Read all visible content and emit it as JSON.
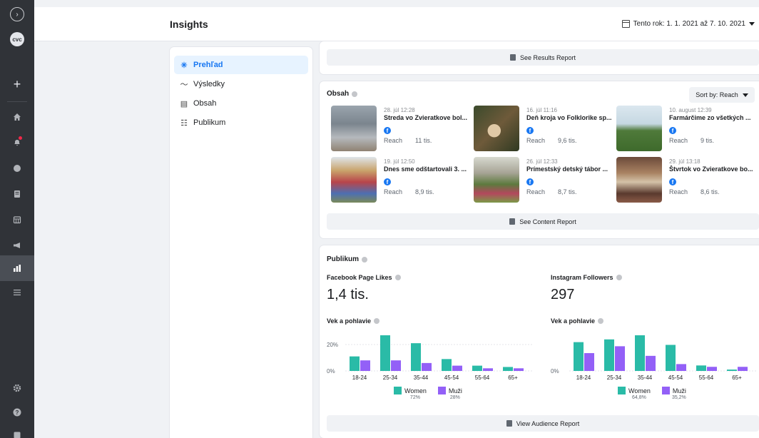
{
  "app": {
    "title": "Insights",
    "date_range": "Tento rok: 1. 1. 2021 až 7. 10. 2021"
  },
  "rail": {
    "logo_text": "cvc",
    "items": [
      "meta-icon",
      "logo",
      "plus-icon",
      "home-icon",
      "notifications-icon",
      "chat-icon",
      "pages-icon",
      "calendar-icon",
      "ads-icon",
      "insights-icon",
      "menu-icon",
      "settings-icon",
      "help-icon",
      "profile-icon"
    ]
  },
  "nav": {
    "items": [
      {
        "label": "Prehľad",
        "icon": "overview-icon",
        "active": true
      },
      {
        "label": "Výsledky",
        "icon": "results-icon",
        "active": false
      },
      {
        "label": "Obsah",
        "icon": "content-icon",
        "active": false
      },
      {
        "label": "Publikum",
        "icon": "audience-icon",
        "active": false
      }
    ]
  },
  "results_card": {
    "button_label": "See Results Report"
  },
  "content_card": {
    "title": "Obsah",
    "sort_label": "Sort by: Reach",
    "reach_label": "Reach",
    "button_label": "See Content Report",
    "posts": [
      {
        "date": "28. júl 12:28",
        "title": "Streda vo Zvieratkove bol...",
        "reach": "11 tis."
      },
      {
        "date": "16. júl 11:16",
        "title": "Deň kroja vo Folklorike sp...",
        "reach": "9,6 tis."
      },
      {
        "date": "10. august 12:39",
        "title": "Farmárčime zo všetkých ...",
        "reach": "9 tis."
      },
      {
        "date": "19. júl 12:50",
        "title": "Dnes sme odštartovali 3. ...",
        "reach": "8,9 tis."
      },
      {
        "date": "26. júl 12:33",
        "title": "Prímestský detský tábor ...",
        "reach": "8,7 tis."
      },
      {
        "date": "29. júl 13:18",
        "title": "Štvrtok vo Zvieratkove bo...",
        "reach": "8,6 tis."
      }
    ]
  },
  "audience_card": {
    "title": "Publikum",
    "button_label": "View Audience Report",
    "facebook": {
      "label": "Facebook Page Likes",
      "value": "1,4 tis.",
      "chart_label": "Vek a pohlavie",
      "legend": [
        {
          "name": "Women",
          "pct": "72%",
          "color": "#2abba7"
        },
        {
          "name": "Muži",
          "pct": "28%",
          "color": "#9360f7"
        }
      ]
    },
    "instagram": {
      "label": "Instagram Followers",
      "value": "297",
      "chart_label": "Vek a pohlavie",
      "legend": [
        {
          "name": "Women",
          "pct": "64,8%",
          "color": "#2abba7"
        },
        {
          "name": "Muži",
          "pct": "35,2%",
          "color": "#9360f7"
        }
      ]
    }
  },
  "chart_data": [
    {
      "type": "bar",
      "categories": [
        "18-24",
        "25-34",
        "35-44",
        "45-54",
        "55-64",
        "65+"
      ],
      "series": [
        {
          "name": "Women",
          "values": [
            11,
            27,
            21,
            9,
            4,
            3
          ]
        },
        {
          "name": "Muži",
          "values": [
            8,
            8,
            6,
            4,
            2,
            2
          ]
        }
      ],
      "ytick_labels": [
        "0%",
        "20%"
      ],
      "ylim": [
        0,
        27
      ]
    },
    {
      "type": "bar",
      "categories": [
        "18-24",
        "25-34",
        "35-44",
        "45-54",
        "55-64",
        "65+"
      ],
      "series": [
        {
          "name": "Women",
          "values": [
            21,
            23,
            26,
            19,
            4,
            1
          ]
        },
        {
          "name": "Muži",
          "values": [
            13,
            18,
            11,
            5,
            3,
            3
          ]
        }
      ],
      "ytick_labels": [
        "0%"
      ],
      "ylim": [
        0,
        26
      ]
    }
  ]
}
